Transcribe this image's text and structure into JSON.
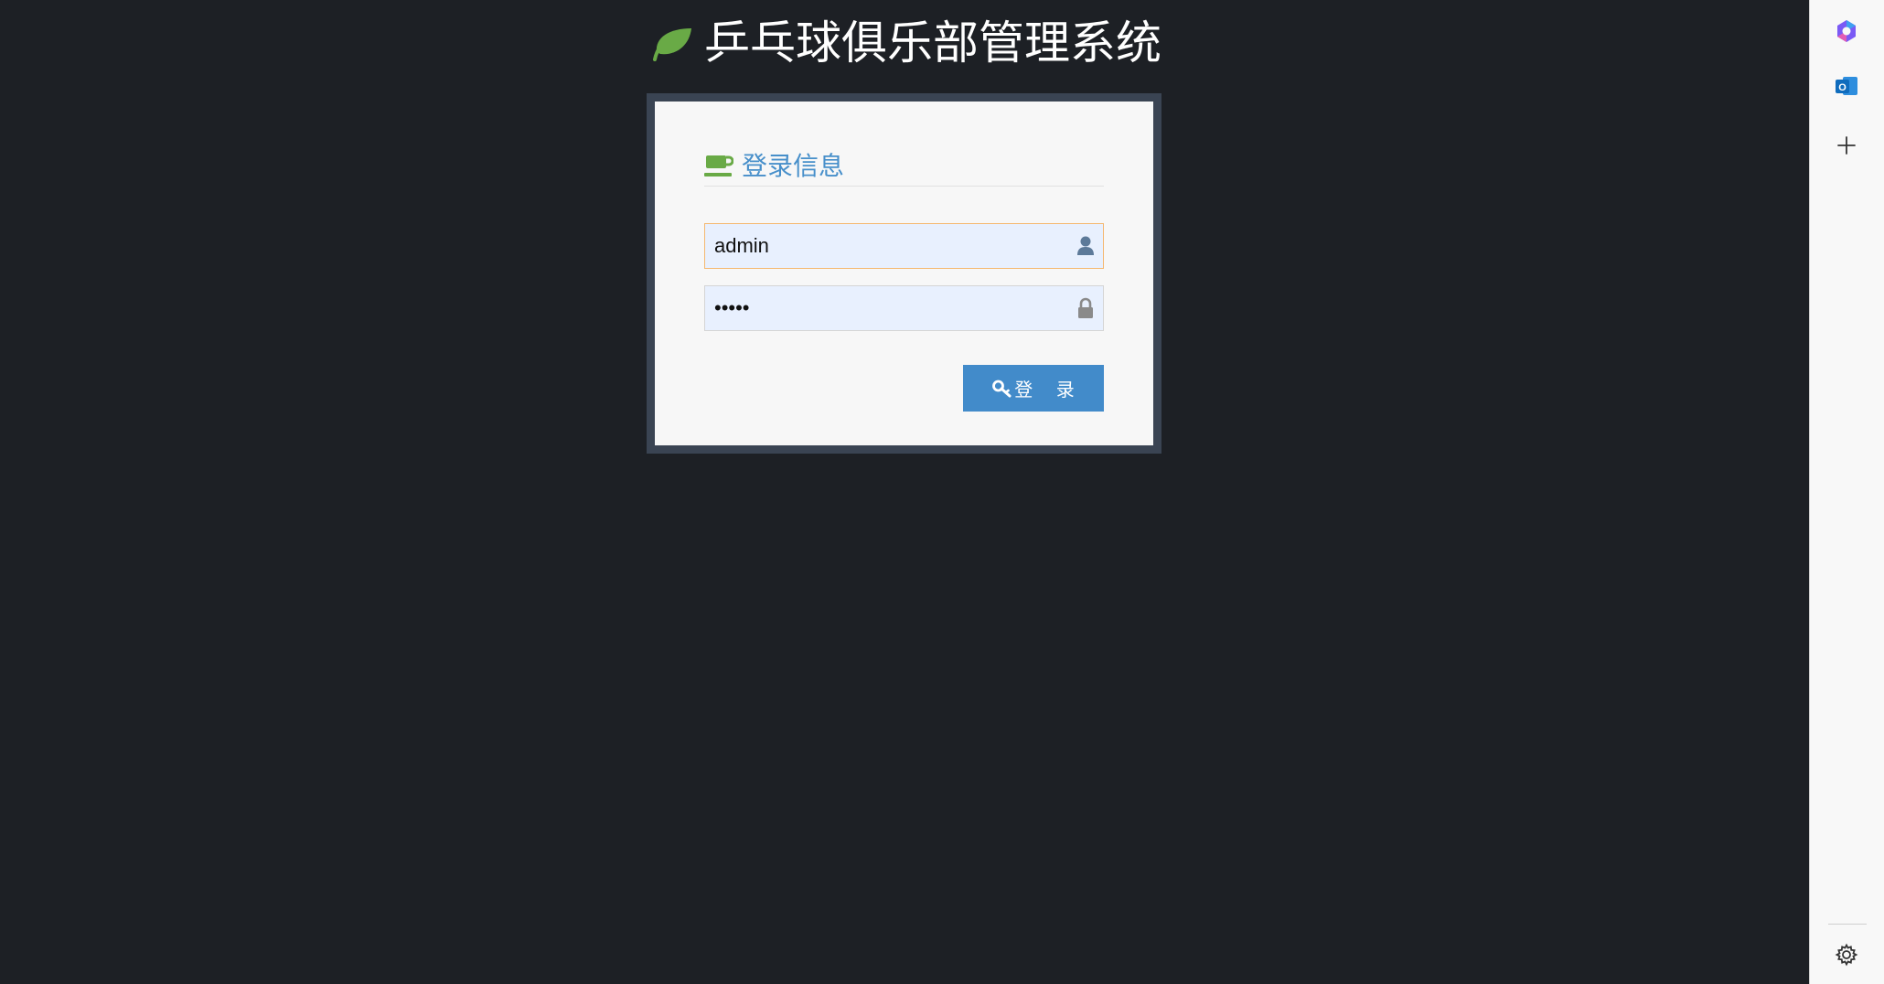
{
  "header": {
    "title": "乒乓球俱乐部管理系统",
    "icon": "leaf-icon"
  },
  "login": {
    "box_title": "登录信息",
    "box_icon": "coffee-cup-icon",
    "username": {
      "value": "admin",
      "icon": "user-icon"
    },
    "password": {
      "value": "•••••",
      "icon": "lock-icon"
    },
    "submit_label": "登 录",
    "submit_icon": "key-icon"
  },
  "sidebar": {
    "items": [
      {
        "name": "copilot-icon"
      },
      {
        "name": "outlook-icon"
      },
      {
        "name": "add-icon"
      }
    ],
    "settings_icon": "settings-gear-icon"
  },
  "colors": {
    "background": "#1d2025",
    "frame": "#3a4453",
    "box": "#f7f7f7",
    "accent_blue": "#478fca",
    "button": "#428bca",
    "leaf_green": "#69aa46",
    "input_fill": "#e8f0fe",
    "input_focus_border": "#f5b870"
  }
}
